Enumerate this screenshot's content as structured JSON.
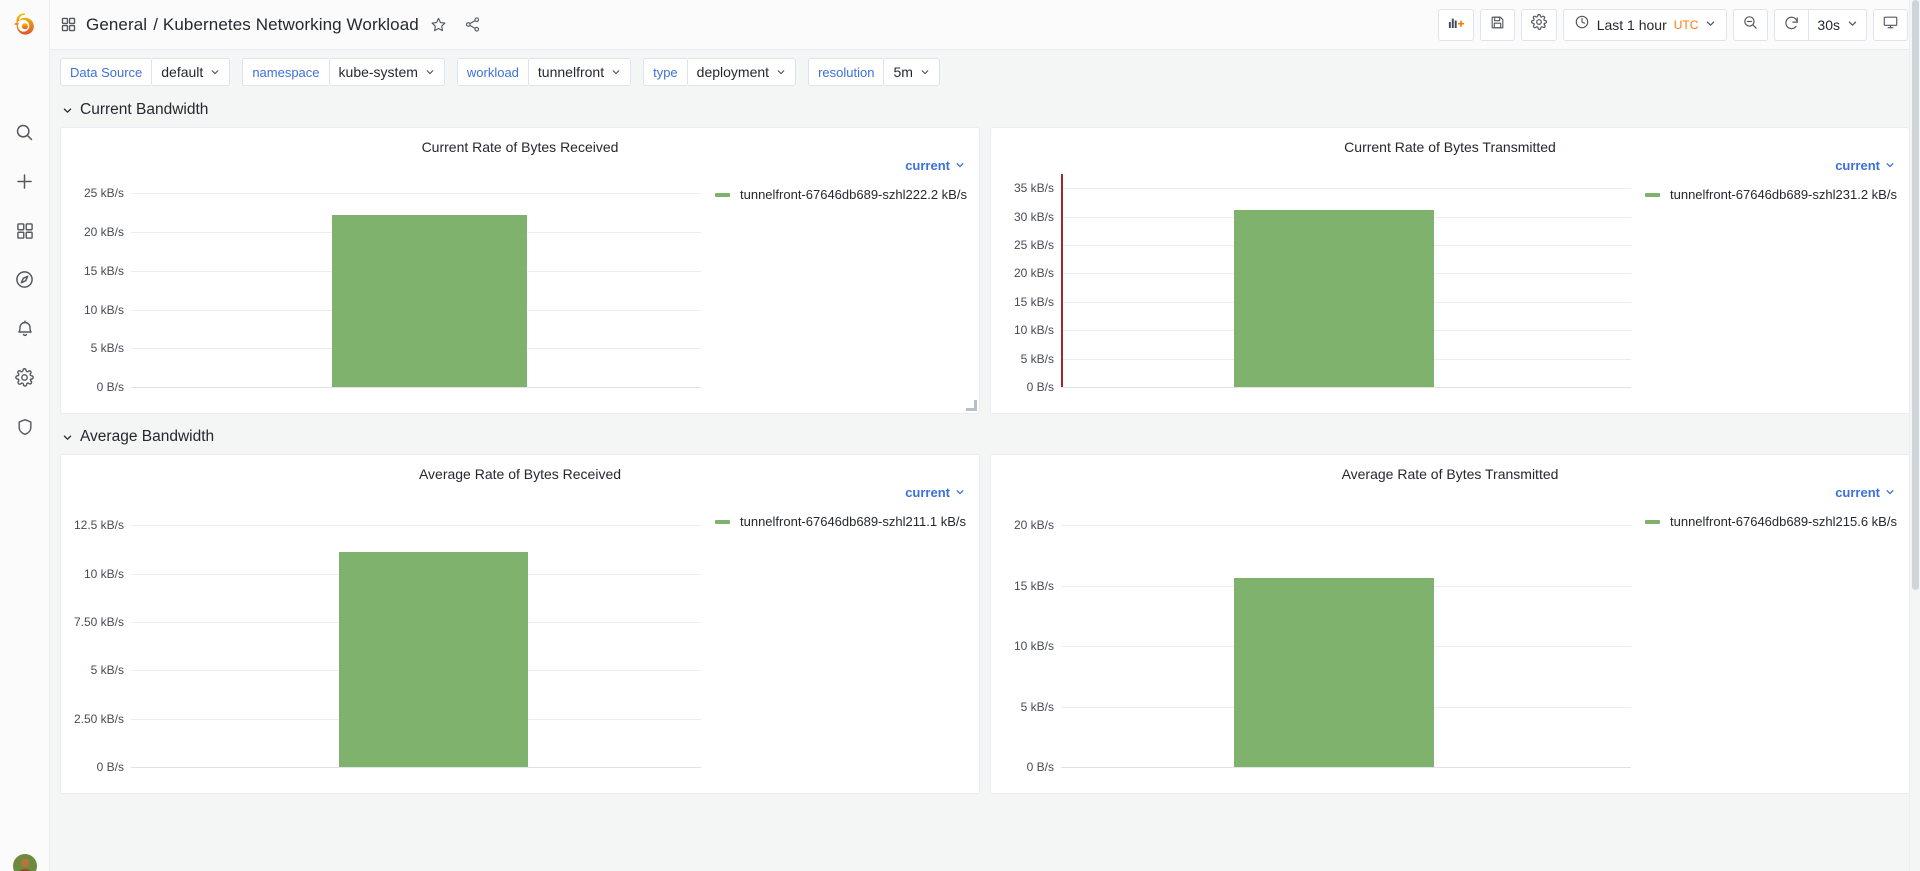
{
  "sidenav": {
    "brand": "grafana-logo",
    "items": [
      {
        "name": "search-icon",
        "label": "Search"
      },
      {
        "name": "plus-icon",
        "label": "Create"
      },
      {
        "name": "dashboards-icon",
        "label": "Dashboards"
      },
      {
        "name": "compass-icon",
        "label": "Explore"
      },
      {
        "name": "bell-icon",
        "label": "Alerting"
      },
      {
        "name": "gear-icon",
        "label": "Configuration"
      },
      {
        "name": "shield-icon",
        "label": "Server Admin"
      }
    ],
    "avatar": "user-avatar"
  },
  "topnav": {
    "folder": "General",
    "separator": "/",
    "title": "Kubernetes Networking Workload",
    "star_icon": "star-icon",
    "share_icon": "share-icon",
    "dashboard_icon": "dashboard-grid-icon",
    "actions": {
      "add_panel": "add-panel-icon",
      "save": "save-icon",
      "settings": "settings-gear-icon",
      "zoom_out": "zoom-out-icon",
      "refresh": "refresh-icon",
      "tv_mode": "tv-mode-icon"
    },
    "time_picker": {
      "clock_icon": "clock-icon",
      "range": "Last 1 hour",
      "timezone": "UTC",
      "caret": "chevron-down-icon"
    },
    "refresh_interval": "30s"
  },
  "variables": [
    {
      "label": "Data Source",
      "value": "default"
    },
    {
      "label": "namespace",
      "value": "kube-system"
    },
    {
      "label": "workload",
      "value": "tunnelfront"
    },
    {
      "label": "type",
      "value": "deployment"
    },
    {
      "label": "resolution",
      "value": "5m"
    }
  ],
  "rows": [
    {
      "title": "Current Bandwidth",
      "collapsed": false,
      "panels": [
        {
          "title": "Current Rate of Bytes Received",
          "legend_header": "current",
          "series_name": "tunnelfront-67646db689-szhl2",
          "series_value": "22.2 kB/s",
          "has_axis_rule": false,
          "has_resize_handle": true
        },
        {
          "title": "Current Rate of Bytes Transmitted",
          "legend_header": "current",
          "series_name": "tunnelfront-67646db689-szhl2",
          "series_value": "31.2 kB/s",
          "has_axis_rule": true,
          "has_resize_handle": false
        }
      ]
    },
    {
      "title": "Average Bandwidth",
      "collapsed": false,
      "panels": [
        {
          "title": "Average Rate of Bytes Received",
          "legend_header": "current",
          "series_name": "tunnelfront-67646db689-szhl2",
          "series_value": "11.1 kB/s",
          "has_axis_rule": false,
          "has_resize_handle": false
        },
        {
          "title": "Average Rate of Bytes Transmitted",
          "legend_header": "current",
          "series_name": "tunnelfront-67646db689-szhl2",
          "series_value": "15.6 kB/s",
          "has_axis_rule": false,
          "has_resize_handle": false
        }
      ]
    }
  ],
  "colors": {
    "series_green": "#7eb26d",
    "accent_blue": "#3d71d9",
    "utc_orange": "#ff780a",
    "axis_rule_red": "#a4262c",
    "grid": "#e9edf2",
    "page_bg": "#f4f5f5",
    "panel_bg": "#ffffff"
  },
  "chart_data": [
    {
      "type": "bar",
      "title": "Current Rate of Bytes Received",
      "xlabel": "",
      "ylabel": "",
      "unit": "kB/s",
      "ylim": [
        0,
        27.5
      ],
      "ticks": [
        {
          "value": 25,
          "label": "25 kB/s"
        },
        {
          "value": 20,
          "label": "20 kB/s"
        },
        {
          "value": 15,
          "label": "15 kB/s"
        },
        {
          "value": 10,
          "label": "10 kB/s"
        },
        {
          "value": 5,
          "label": "5 kB/s"
        },
        {
          "value": 0,
          "label": "0 B/s"
        }
      ],
      "grid": true,
      "legend_position": "right",
      "series": [
        {
          "name": "tunnelfront-67646db689-szhl2",
          "color": "#7eb26d",
          "current": 22.2,
          "bar": {
            "value": 22.2,
            "x_start_frac": 0.352,
            "x_end_frac": 0.695
          }
        }
      ]
    },
    {
      "type": "bar",
      "title": "Current Rate of Bytes Transmitted",
      "xlabel": "",
      "ylabel": "",
      "unit": "kB/s",
      "ylim": [
        0,
        37.5
      ],
      "ticks": [
        {
          "value": 35,
          "label": "35 kB/s"
        },
        {
          "value": 30,
          "label": "30 kB/s"
        },
        {
          "value": 25,
          "label": "25 kB/s"
        },
        {
          "value": 20,
          "label": "20 kB/s"
        },
        {
          "value": 15,
          "label": "15 kB/s"
        },
        {
          "value": 10,
          "label": "10 kB/s"
        },
        {
          "value": 5,
          "label": "5 kB/s"
        },
        {
          "value": 0,
          "label": "0 B/s"
        }
      ],
      "grid": true,
      "legend_position": "right",
      "axis_rule_color": "#a4262c",
      "series": [
        {
          "name": "tunnelfront-67646db689-szhl2",
          "color": "#7eb26d",
          "current": 31.2,
          "bar": {
            "value": 31.2,
            "x_start_frac": 0.304,
            "x_end_frac": 0.655
          }
        }
      ]
    },
    {
      "type": "bar",
      "title": "Average Rate of Bytes Received",
      "xlabel": "",
      "ylabel": "",
      "unit": "kB/s",
      "ylim": [
        0,
        13.75
      ],
      "ticks": [
        {
          "value": 12.5,
          "label": "12.5 kB/s"
        },
        {
          "value": 10,
          "label": "10 kB/s"
        },
        {
          "value": 7.5,
          "label": "7.50 kB/s"
        },
        {
          "value": 5,
          "label": "5 kB/s"
        },
        {
          "value": 2.5,
          "label": "2.50 kB/s"
        },
        {
          "value": 0,
          "label": "0 B/s"
        }
      ],
      "grid": true,
      "legend_position": "right",
      "series": [
        {
          "name": "tunnelfront-67646db689-szhl2",
          "color": "#7eb26d",
          "current": 11.1,
          "bar": {
            "value": 11.1,
            "x_start_frac": 0.365,
            "x_end_frac": 0.697
          }
        }
      ]
    },
    {
      "type": "bar",
      "title": "Average Rate of Bytes Transmitted",
      "xlabel": "",
      "ylabel": "",
      "unit": "kB/s",
      "ylim": [
        0,
        22
      ],
      "ticks": [
        {
          "value": 20,
          "label": "20 kB/s"
        },
        {
          "value": 15,
          "label": "15 kB/s"
        },
        {
          "value": 10,
          "label": "10 kB/s"
        },
        {
          "value": 5,
          "label": "5 kB/s"
        },
        {
          "value": 0,
          "label": "0 B/s"
        }
      ],
      "grid": true,
      "legend_position": "right",
      "series": [
        {
          "name": "tunnelfront-67646db689-szhl2",
          "color": "#7eb26d",
          "current": 15.6,
          "bar": {
            "value": 15.6,
            "x_start_frac": 0.304,
            "x_end_frac": 0.655
          }
        }
      ]
    }
  ]
}
